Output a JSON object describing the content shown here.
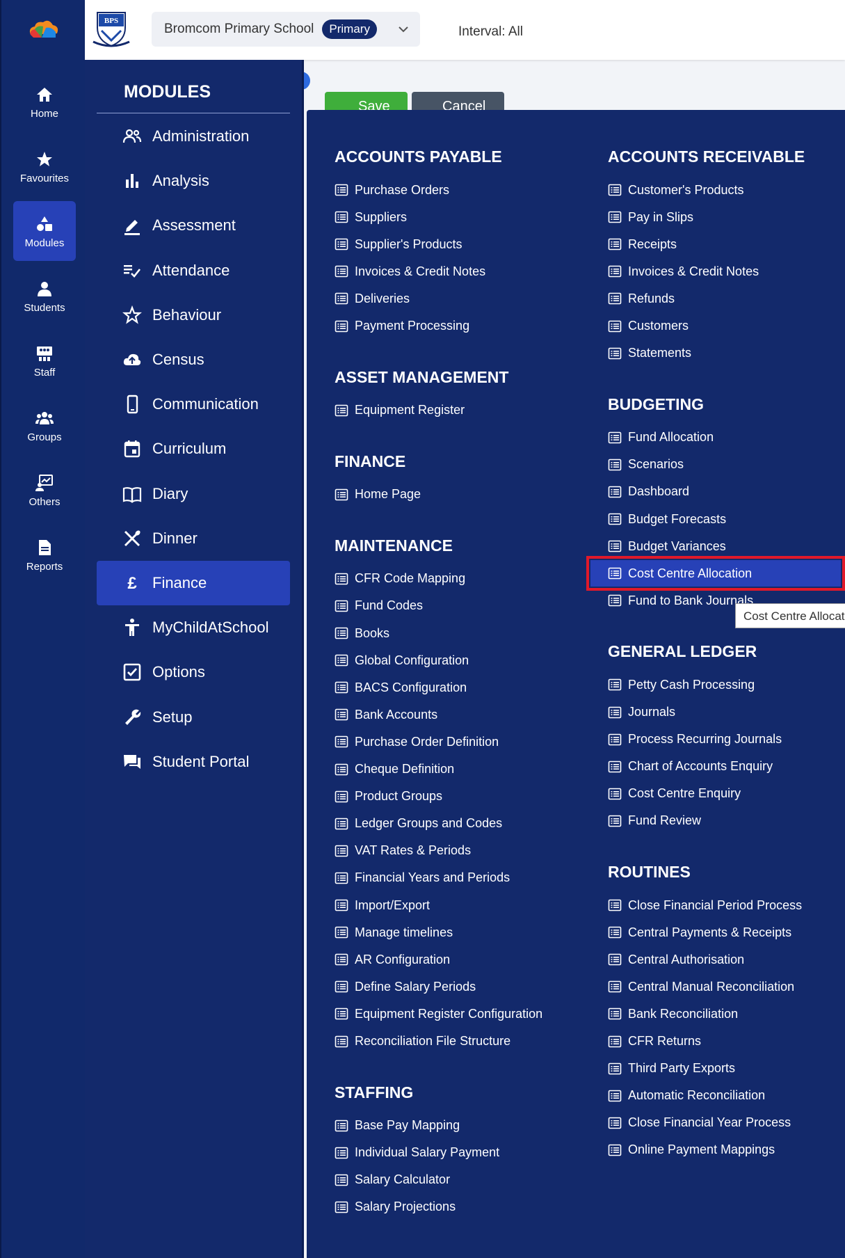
{
  "colors": {
    "navy": "#13296b",
    "active_blue": "#2741b7",
    "highlight_border": "#e0192a",
    "save_green": "#3fae3b",
    "cancel_gray": "#475465"
  },
  "rail": {
    "items": [
      {
        "label": "Home",
        "icon": "home-icon"
      },
      {
        "label": "Favourites",
        "icon": "star-icon"
      },
      {
        "label": "Modules",
        "icon": "shapes-icon",
        "active": true
      },
      {
        "label": "Students",
        "icon": "person-icon"
      },
      {
        "label": "Staff",
        "icon": "staff-board-icon"
      },
      {
        "label": "Groups",
        "icon": "group-icon"
      },
      {
        "label": "Others",
        "icon": "others-icon"
      },
      {
        "label": "Reports",
        "icon": "document-icon"
      }
    ]
  },
  "header": {
    "crest_text": "BPS",
    "school_name": "Bromcom Primary School",
    "school_type": "Primary",
    "interval": "Interval: All"
  },
  "background": {
    "save_label": "Save",
    "cancel_label": "Cancel"
  },
  "modules": {
    "title": "MODULES",
    "items": [
      {
        "label": "Administration",
        "icon": "people-icon"
      },
      {
        "label": "Analysis",
        "icon": "bar-chart-icon"
      },
      {
        "label": "Assessment",
        "icon": "pencil-icon"
      },
      {
        "label": "Attendance",
        "icon": "checklist-icon"
      },
      {
        "label": "Behaviour",
        "icon": "star-outline-icon"
      },
      {
        "label": "Census",
        "icon": "cloud-upload-icon"
      },
      {
        "label": "Communication",
        "icon": "phone-icon"
      },
      {
        "label": "Curriculum",
        "icon": "calendar-icon"
      },
      {
        "label": "Diary",
        "icon": "book-icon"
      },
      {
        "label": "Dinner",
        "icon": "cutlery-icon"
      },
      {
        "label": "Finance",
        "icon": "pound-icon",
        "active": true
      },
      {
        "label": "MyChildAtSchool",
        "icon": "accessibility-icon"
      },
      {
        "label": "Options",
        "icon": "checkbox-icon"
      },
      {
        "label": "Setup",
        "icon": "wrench-icon"
      },
      {
        "label": "Student Portal",
        "icon": "chat-icon"
      }
    ]
  },
  "finance_menu": {
    "left": [
      {
        "heading": "ACCOUNTS PAYABLE",
        "items": [
          "Purchase Orders",
          "Suppliers",
          "Supplier's Products",
          "Invoices & Credit Notes",
          "Deliveries",
          "Payment Processing"
        ]
      },
      {
        "heading": "ASSET MANAGEMENT",
        "items": [
          "Equipment Register"
        ]
      },
      {
        "heading": "FINANCE",
        "items": [
          "Home Page"
        ]
      },
      {
        "heading": "MAINTENANCE",
        "items": [
          "CFR Code Mapping",
          "Fund Codes",
          "Books",
          "Global Configuration",
          "BACS Configuration",
          "Bank Accounts",
          "Purchase Order Definition",
          "Cheque Definition",
          "Product Groups",
          "Ledger Groups and Codes",
          "VAT Rates & Periods",
          "Financial Years and Periods",
          "Import/Export",
          "Manage timelines",
          "AR Configuration",
          "Define Salary Periods",
          "Equipment Register Configuration",
          "Reconciliation File Structure"
        ]
      },
      {
        "heading": "STAFFING",
        "items": [
          "Base Pay Mapping",
          "Individual Salary Payment",
          "Salary Calculator",
          "Salary Projections"
        ]
      }
    ],
    "right": [
      {
        "heading": "ACCOUNTS RECEIVABLE",
        "items": [
          "Customer's Products",
          "Pay in Slips",
          "Receipts",
          "Invoices & Credit Notes",
          "Refunds",
          "Customers",
          "Statements"
        ]
      },
      {
        "heading": "BUDGETING",
        "items": [
          "Fund Allocation",
          "Scenarios",
          "Dashboard",
          "Budget Forecasts",
          "Budget Variances",
          "Cost Centre Allocation",
          "Fund to Bank Journals"
        ],
        "highlighted": "Cost Centre Allocation"
      },
      {
        "heading": "GENERAL LEDGER",
        "items": [
          "Petty Cash Processing",
          "Journals",
          "Process Recurring Journals",
          "Chart of Accounts Enquiry",
          "Cost Centre Enquiry",
          "Fund Review"
        ]
      },
      {
        "heading": "ROUTINES",
        "items": [
          "Close Financial Period Process",
          "Central Payments & Receipts",
          "Central Authorisation",
          "Central Manual Reconciliation",
          "Bank Reconciliation",
          "CFR Returns",
          "Third Party Exports",
          "Automatic Reconciliation",
          "Close Financial Year Process",
          "Online Payment Mappings"
        ]
      }
    ]
  },
  "tooltip": {
    "text": "Cost Centre Allocation"
  }
}
